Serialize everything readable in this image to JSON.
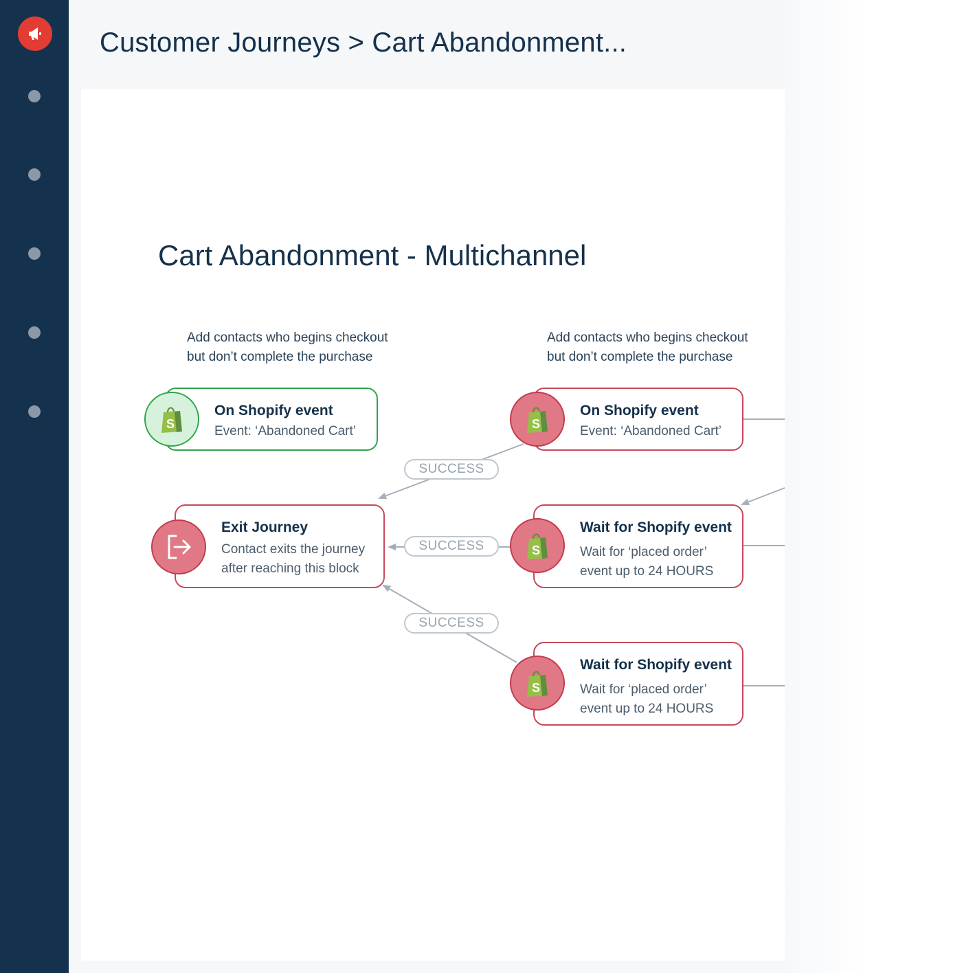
{
  "breadcrumb": "Customer Journeys > Cart Abandonment...",
  "journey_title": "Cart Abandonment - Multichannel",
  "captions": [
    {
      "line1": "Add contacts who begins checkout",
      "line2": "but don’t complete the purchase"
    },
    {
      "line1": "Add contacts who begins checkout",
      "line2": "but don’t complete the purchase"
    }
  ],
  "blocks": {
    "trigger_left": {
      "title": "On Shopify event",
      "line1": "Event: ‘Abandoned Cart’",
      "icon": "shopify-icon",
      "color": "#2ea64b"
    },
    "trigger_right": {
      "title": "On Shopify event",
      "line1": "Event: ‘Abandoned Cart’",
      "icon": "shopify-icon",
      "color": "#c8495a"
    },
    "exit": {
      "title": "Exit Journey",
      "line1": "Contact exits the journey",
      "line2": "after reaching this block",
      "icon": "exit-icon"
    },
    "wait_1": {
      "title": "Wait for Shopify event",
      "line1": "Wait for ‘placed order’",
      "line2": "event up to 24 HOURS",
      "icon": "shopify-icon"
    },
    "wait_2": {
      "title": "Wait for Shopify event",
      "line1": "Wait for ‘placed order’",
      "line2": "event up to 24 HOURS",
      "icon": "shopify-icon"
    }
  },
  "edge_labels": [
    "SUCCESS",
    "SUCCESS",
    "SUCCESS"
  ],
  "sidebar": {
    "logo_icon": "megaphone-icon",
    "nav_items": 5
  },
  "colors": {
    "sidebar": "#14324d",
    "brand": "#e23c33",
    "success_green": "#2ea64b",
    "alert_red": "#c8495a"
  }
}
